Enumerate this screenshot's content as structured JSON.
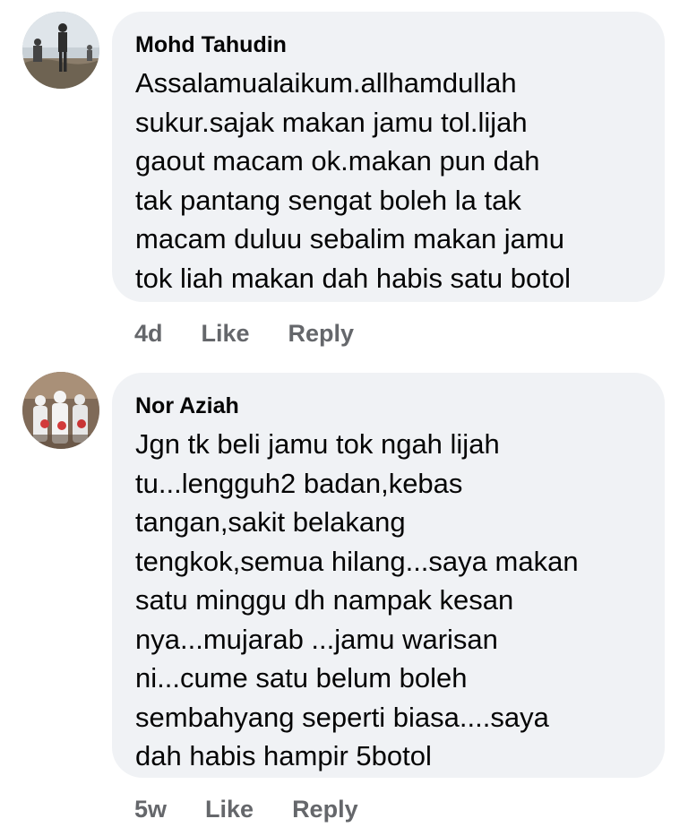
{
  "comments": [
    {
      "author": "Mohd Tahudin",
      "avatar_icon": "profile-photo-avatar",
      "lines": [
        "Assalamualaikum.allhamdullah",
        "sukur.sajak makan jamu tol.lijah",
        "gaout  macam  ok.makan  pun dah",
        "tak pantang sengat boleh la tak",
        "macam duluu sebalim makan jamu",
        "tok liah makan dah habis satu botol"
      ],
      "age": "4d",
      "like_label": "Like",
      "reply_label": "Reply"
    },
    {
      "author": "Nor Aziah",
      "avatar_icon": "profile-photo-avatar",
      "lines": [
        "Jgn tk beli jamu tok ngah lijah",
        "tu...lengguh2 badan,kebas",
        "tangan,sakit belakang",
        "tengkok,semua hilang...saya makan",
        "satu minggu dh nampak kesan",
        "nya...mujarab ...jamu warisan",
        "ni...cume satu belum boleh",
        "sembahyang seperti biasa....saya",
        "dah habis hampir 5botol"
      ],
      "age": "5w",
      "like_label": "Like",
      "reply_label": "Reply"
    }
  ],
  "colors": {
    "bubble_bg": "#f0f2f5",
    "text": "#050505",
    "secondary_text": "#65676b"
  }
}
